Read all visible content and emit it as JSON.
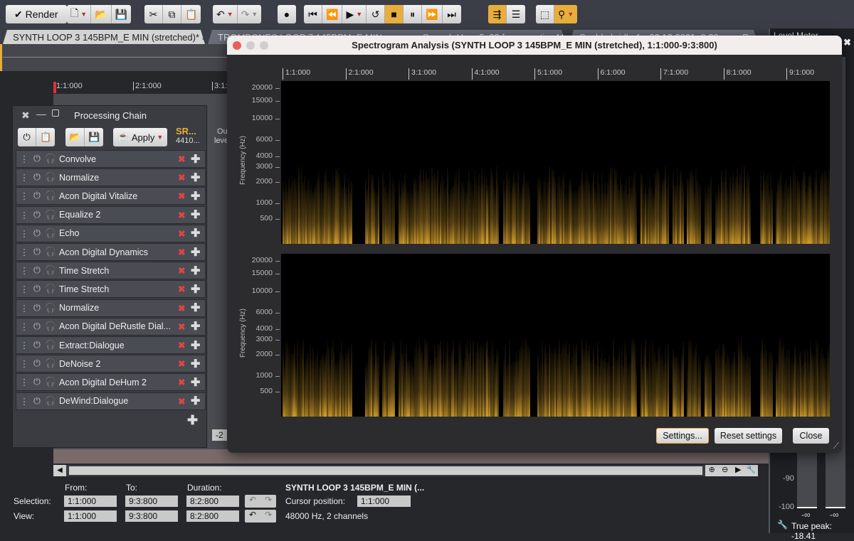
{
  "toolbar": {
    "render_label": "Render",
    "accent": "#e9ad3b"
  },
  "tabs": [
    {
      "label": "SYNTH LOOP 3 145BPM_E MIN (stretched)*",
      "active": true
    },
    {
      "label": "TROMBONES LOOP 7 145BPM_E MIN.wav"
    },
    {
      "label": "Speech Hero 5x22 for acoustics M..."
    },
    {
      "label": "Seolde bridle 1 - 22:12:2021, 9:20 am - Re..."
    }
  ],
  "level_meter": {
    "title": "Level Meter",
    "scale": [
      "-90",
      "-100"
    ],
    "left": "-∞",
    "right": "-∞",
    "true_peak": "True peak: -18.41"
  },
  "ruler": [
    "1:1:000",
    "2:1:000",
    "3:1:"
  ],
  "processing_chain": {
    "title": "Processing Chain",
    "apply_label": "Apply",
    "sr_label": "SR...",
    "sr_value": "4410...",
    "output_label": "Ou",
    "output_label2": "leve",
    "items": [
      "Convolve",
      "Normalize",
      "Acon Digital Vitalize",
      "Equalize 2",
      "Echo",
      "Acon Digital Dynamics",
      "Time Stretch",
      "Time Stretch",
      "Normalize",
      "Acon Digital DeRustle Dial...",
      "Extract:Dialogue",
      "DeNoise 2",
      "Acon Digital DeHum 2",
      "DeWind:Dialogue"
    ]
  },
  "spectrogram": {
    "title": "Spectrogram Analysis (SYNTH LOOP 3 145BPM_E MIN (stretched), 1:1:000-9:3:800)",
    "time_ticks": [
      "1:1:000",
      "2:1:000",
      "3:1:000",
      "4:1:000",
      "5:1:000",
      "6:1:000",
      "7:1:000",
      "8:1:000",
      "9:1:000"
    ],
    "freq_ticks": [
      20000,
      15000,
      10000,
      6000,
      4000,
      3000,
      2000,
      1000,
      500
    ],
    "y_axis_title": "Frequency (Hz)",
    "settings_label": "Settings...",
    "reset_label": "Reset settings",
    "close_label": "Close",
    "color": "#e0a830"
  },
  "partial_field": "-2",
  "bottom": {
    "from_label": "From:",
    "to_label": "To:",
    "duration_label": "Duration:",
    "selection_label": "Selection:",
    "view_label": "View:",
    "selection": {
      "from": "1:1:000",
      "to": "9:3:800",
      "duration": "8:2:800"
    },
    "view": {
      "from": "1:1:000",
      "to": "9:3:800",
      "duration": "8:2:800"
    },
    "file_title": "SYNTH LOOP 3 145BPM_E MIN (...",
    "cursor_label": "Cursor position:",
    "cursor_value": "1:1:000",
    "format": "48000 Hz, 2 channels"
  }
}
